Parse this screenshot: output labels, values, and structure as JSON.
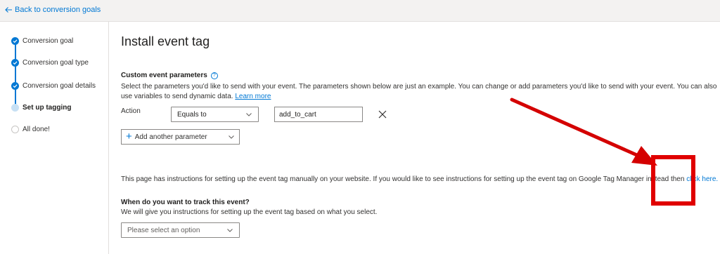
{
  "topbar": {
    "back_label": "Back to conversion goals"
  },
  "sidebar": {
    "steps": [
      {
        "label": "Conversion goal",
        "state": "done"
      },
      {
        "label": "Conversion goal type",
        "state": "done"
      },
      {
        "label": "Conversion goal details",
        "state": "done"
      },
      {
        "label": "Set up tagging",
        "state": "current"
      },
      {
        "label": "All done!",
        "state": "todo"
      }
    ]
  },
  "main": {
    "title": "Install event tag",
    "custom_params": {
      "title": "Custom event parameters",
      "description": "Select the parameters you'd like to send with your event. The parameters shown below are just an example. You can change or add parameters you'd like to send with your event. You can also use variables to send dynamic data.",
      "learn_more": "Learn more",
      "row": {
        "label": "Action",
        "operator": "Equals to",
        "value": "add_to_cart"
      },
      "add_button": "Add another parameter"
    },
    "instructions": {
      "text": "This page has instructions for setting up the event tag manually on your website. If you would like to see instructions for setting up the event tag on Google Tag Manager instead then",
      "link": "click here."
    },
    "track": {
      "title": "When do you want to track this event?",
      "subtitle": "We will give you instructions for setting up the event tag based on what you select.",
      "placeholder": "Please select an option"
    }
  },
  "colors": {
    "accent": "#0078d4",
    "annotation": "#d40000"
  }
}
